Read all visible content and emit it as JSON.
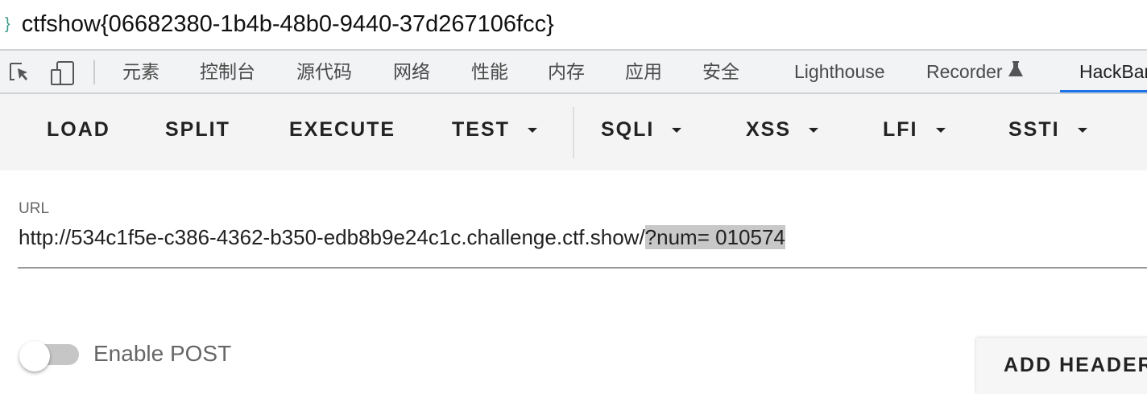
{
  "page": {
    "brace": "}",
    "flag_text": "ctfshow{06682380-1b4b-48b0-9440-37d267106fcc}"
  },
  "devtools": {
    "tabs": [
      "元素",
      "控制台",
      "源代码",
      "网络",
      "性能",
      "内存",
      "应用",
      "安全",
      "Lighthouse",
      "Recorder",
      "HackBar"
    ],
    "active_tab": "HackBar",
    "accent": "#1a73e8"
  },
  "hackbar": {
    "buttons": {
      "load": "LOAD",
      "split": "SPLIT",
      "execute": "EXECUTE",
      "test": "TEST",
      "sqli": "SQLI",
      "xss": "XSS",
      "lfi": "LFI",
      "ssti": "SSTI"
    },
    "url_label": "URL",
    "url_prefix": "http://534c1f5e-c386-4362-b350-edb8b9e24c1c.challenge.ctf.show/",
    "url_selected": "?num= 010574",
    "enable_post_label": "Enable POST",
    "enable_post": false,
    "add_header": "ADD HEADER"
  }
}
